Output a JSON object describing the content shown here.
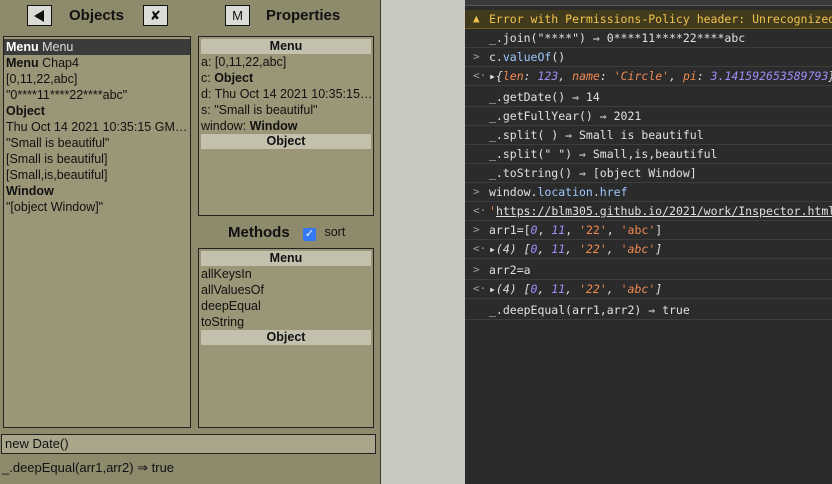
{
  "inspector": {
    "back_icon": "left-triangle-icon",
    "objects_title": "Objects",
    "close_label": "✘",
    "m_label": "M",
    "properties_title": "Properties",
    "objects_list": [
      {
        "k": "Menu",
        "v": " Menu",
        "selected": true
      },
      {
        "k": "Menu",
        "v": " Chap4"
      },
      {
        "v": "[0,11,22,abc]"
      },
      {
        "v": "\"0****11****22****abc\""
      },
      {
        "k": "Object",
        "v": ""
      },
      {
        "v": "Thu Oct 14 2021 10:35:15 GMT..."
      },
      {
        "v": "\"Small is beautiful\""
      },
      {
        "v": "[Small is beautiful]"
      },
      {
        "v": "[Small,is,beautiful]"
      },
      {
        "k": "Window",
        "v": ""
      },
      {
        "v": "\"[object Window]\""
      }
    ],
    "properties_header": "Menu",
    "properties_list": [
      {
        "k": "a:",
        "v": " [0,11,22,abc]"
      },
      {
        "k": "c:",
        "v": " Object",
        "bold_v": true
      },
      {
        "k": "d:",
        "v": " Thu Oct 14 2021 10:35:15 ..."
      },
      {
        "k": "s:",
        "v": " \"Small is beautiful\""
      },
      {
        "k": "window:",
        "v": " Window",
        "bold_v": true
      }
    ],
    "properties_footer": "Object",
    "methods_title": "Methods",
    "sort_label": "sort",
    "sort_checked": "✓",
    "methods_header": "Menu",
    "methods_list": [
      "allKeysIn",
      "allValuesOf",
      "deepEqual",
      "toString"
    ],
    "methods_footer": "Object",
    "input_value": "new Date()",
    "result_text": "_.deepEqual(arr1,arr2) ⇒ true"
  },
  "console": {
    "warning": "Error with Permissions-Policy header: Unrecognized f",
    "lines": [
      {
        "g": "",
        "t": "_.join(\"****\") ⇒ 0****11****22****abc"
      },
      {
        "g": ">",
        "t": "c.valueOf()"
      },
      {
        "g": "<·",
        "t": "▸{len: 123, name: 'Circle', pi: 3.141592653589793}"
      },
      {
        "g": "",
        "t": "_.getDate() ⇒ 14"
      },
      {
        "g": "",
        "t": "_.getFullYear() ⇒ 2021"
      },
      {
        "g": "",
        "t": "_.split( ) ⇒ Small is beautiful"
      },
      {
        "g": "",
        "t": "_.split(\" \") ⇒ Small,is,beautiful"
      },
      {
        "g": "",
        "t": "_.toString() ⇒ [object Window]"
      },
      {
        "g": ">",
        "t": "window.location.href"
      },
      {
        "g": "<·",
        "t": "'https://blm305.github.io/2021/work/Inspector.html'"
      },
      {
        "g": ">",
        "t": "arr1=[0, 11, '22', 'abc']"
      },
      {
        "g": "<·",
        "t": "▸(4) [0, 11, '22', 'abc']"
      },
      {
        "g": ">",
        "t": "arr2=a"
      },
      {
        "g": "<·",
        "t": "▸(4) [0, 11, '22', 'abc']"
      },
      {
        "g": "",
        "t": "_.deepEqual(arr1,arr2) ⇒ true"
      }
    ],
    "prompt": ">"
  },
  "colors": {
    "panel_bg": "#8e8a6c",
    "console_bg": "#2b2b2b",
    "warning_text": "#f3c24a",
    "string_orange": "#f28b54",
    "number_purple": "#a18dfa"
  }
}
